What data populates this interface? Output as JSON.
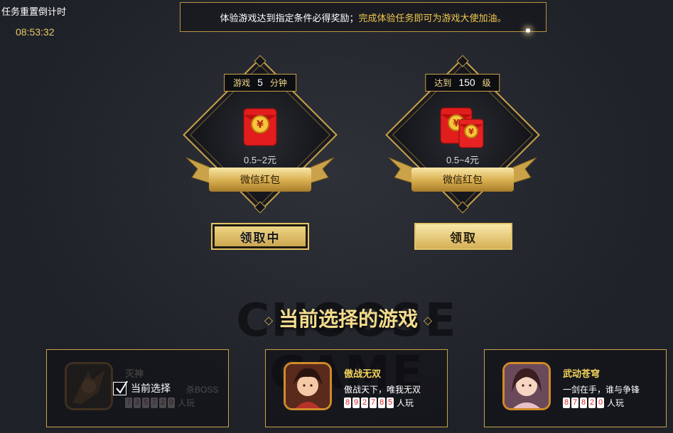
{
  "countdown": {
    "label": "任务重置倒计时",
    "time": "08:53:32"
  },
  "notice": {
    "part1": "体验游戏达到指定条件必得奖励；",
    "part2": "完成体验任务即可为游戏大使加油。"
  },
  "rewards": [
    {
      "cond_prefix": "游戏",
      "cond_value": "5",
      "cond_suffix": "分钟",
      "amount": "0.5~2元",
      "type": "微信红包",
      "button": "领取中"
    },
    {
      "cond_prefix": "达到",
      "cond_value": "150",
      "cond_suffix": "级",
      "amount": "0.5~4元",
      "type": "微信红包",
      "button": "领取"
    }
  ],
  "section": {
    "watermark": "CHOOSE GAME",
    "title": "当前选择的游戏"
  },
  "games": [
    {
      "name": "灭神",
      "desc": "杀BOSS",
      "digits": [
        "7",
        "3",
        "5",
        "7",
        "2",
        "9"
      ],
      "unit": "人玩",
      "selected_label": "当前选择"
    },
    {
      "name": "傲战无双",
      "desc": "傲战天下，唯我无双",
      "digits": [
        "8",
        "9",
        "2",
        "7",
        "8",
        "5"
      ],
      "unit": "人玩"
    },
    {
      "name": "武动苍穹",
      "desc": "一剑在手，谁与争锋",
      "digits": [
        "8",
        "7",
        "8",
        "2",
        "0"
      ],
      "unit": "人玩"
    }
  ],
  "colors": {
    "gold": "#c9a24a",
    "accent_text": "#f2c84e",
    "count_digit": "#dd2222"
  }
}
